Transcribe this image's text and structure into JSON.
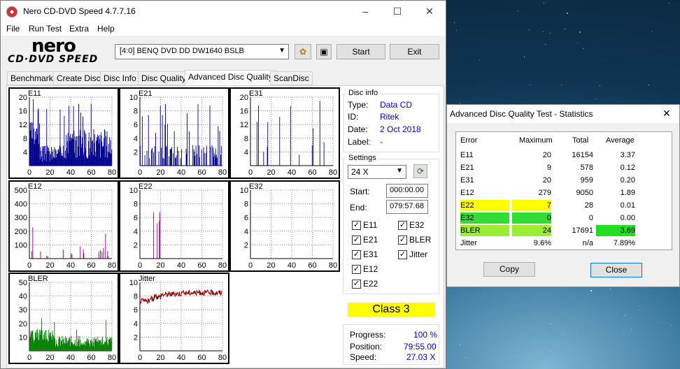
{
  "window": {
    "title": "Nero CD-DVD Speed 4.7.7.16",
    "minimize": "–",
    "maximize": "☐",
    "close": "✕"
  },
  "menu": [
    "File",
    "Run Test",
    "Extra",
    "Help"
  ],
  "logo": {
    "line1": "nero",
    "line2": "CD·DVD SPEED"
  },
  "toolbar": {
    "drive": "[4:0]  BENQ DVD DD DW1640 BSLB",
    "start": "Start",
    "exit": "Exit"
  },
  "tabs": [
    "Benchmark",
    "Create Disc",
    "Disc Info",
    "Disc Quality",
    "Advanced Disc Quality",
    "ScanDisc"
  ],
  "disc_info": {
    "title": "Disc info",
    "type_label": "Type:",
    "type": "Data CD",
    "id_label": "ID:",
    "id": "Ritek",
    "date_label": "Date:",
    "date": "2 Oct 2018",
    "label_label": "Label:",
    "label": "-"
  },
  "settings": {
    "title": "Settings",
    "speed": "24 X",
    "start_label": "Start:",
    "start": "000:00.00",
    "end_label": "End:",
    "end": "079:57.68",
    "checks": [
      {
        "label": "E11",
        "checked": true
      },
      {
        "label": "E32",
        "checked": true
      },
      {
        "label": "E21",
        "checked": true
      },
      {
        "label": "BLER",
        "checked": true
      },
      {
        "label": "E31",
        "checked": true
      },
      {
        "label": "Jitter",
        "checked": true
      },
      {
        "label": "E12",
        "checked": true
      },
      {
        "label": "E22",
        "checked": true
      }
    ]
  },
  "class_label": "Class 3",
  "progress": {
    "progress_label": "Progress:",
    "progress": "100 %",
    "position_label": "Position:",
    "position": "79:55.00",
    "speed_label": "Speed:",
    "speed": "27.03 X"
  },
  "chart_data": [
    {
      "type": "bar",
      "title": "E11",
      "x_ticks": [
        0,
        20,
        40,
        60,
        80
      ],
      "y_ticks": [
        4,
        8,
        12,
        16,
        20
      ],
      "ylim": [
        0,
        20
      ],
      "color": "#00008b",
      "profile": "dense"
    },
    {
      "type": "bar",
      "title": "E21",
      "x_ticks": [
        0,
        20,
        40,
        60,
        80
      ],
      "y_ticks": [
        2,
        4,
        6,
        8,
        10
      ],
      "ylim": [
        0,
        10
      ],
      "color": "#00008b",
      "profile": "mid"
    },
    {
      "type": "bar",
      "title": "E31",
      "x_ticks": [
        0,
        20,
        40,
        60,
        80
      ],
      "y_ticks": [
        4,
        8,
        12,
        16,
        20
      ],
      "ylim": [
        0,
        20
      ],
      "color": "#00008b",
      "profile": "spiky"
    },
    {
      "type": "bar",
      "title": "E12",
      "x_ticks": [
        0,
        20,
        40,
        60,
        80
      ],
      "y_ticks": [
        100,
        200,
        300,
        400,
        500
      ],
      "ylim": [
        0,
        500
      ],
      "color": "#800080",
      "profile": "sparse"
    },
    {
      "type": "bar",
      "title": "E22",
      "x_ticks": [
        0,
        20,
        40,
        60,
        80
      ],
      "y_ticks": [
        2,
        4,
        6,
        8,
        10
      ],
      "ylim": [
        0,
        10
      ],
      "color": "#800080",
      "profile": "e22"
    },
    {
      "type": "bar",
      "title": "E32",
      "x_ticks": [
        0,
        20,
        40,
        60,
        80
      ],
      "y_ticks": [
        2,
        4,
        6,
        8,
        10
      ],
      "ylim": [
        0,
        10
      ],
      "color": "#800080",
      "profile": "none"
    },
    {
      "type": "bar",
      "title": "BLER",
      "x_ticks": [
        0,
        20,
        40,
        60,
        80
      ],
      "y_ticks": [
        10,
        20,
        30,
        40,
        50
      ],
      "ylim": [
        0,
        50
      ],
      "color": "#008000",
      "profile": "bler"
    },
    {
      "type": "line",
      "title": "Jitter",
      "x_ticks": [
        0,
        20,
        40,
        60,
        80
      ],
      "y_ticks": [
        2,
        4,
        6,
        8,
        10
      ],
      "ylim": [
        0,
        10
      ],
      "color": "#8b0000",
      "profile": "jitter"
    }
  ],
  "stats": {
    "title": "Advanced Disc Quality Test - Statistics",
    "headers": [
      "Error",
      "Maximum",
      "Total",
      "Average"
    ],
    "rows": [
      {
        "name": "E11",
        "max": "20",
        "total": "16154",
        "avg": "3.37",
        "hl": ""
      },
      {
        "name": "E21",
        "max": "9",
        "total": "578",
        "avg": "0.12",
        "hl": ""
      },
      {
        "name": "E31",
        "max": "20",
        "total": "959",
        "avg": "0.20",
        "hl": ""
      },
      {
        "name": "E12",
        "max": "279",
        "total": "9050",
        "avg": "1.89",
        "hl": ""
      },
      {
        "name": "E22",
        "max": "7",
        "total": "28",
        "avg": "0.01",
        "hl": "#ffff00"
      },
      {
        "name": "E32",
        "max": "0",
        "total": "0",
        "avg": "0.00",
        "hl": "#33dd33"
      },
      {
        "name": "BLER",
        "max": "24",
        "total": "17691",
        "avg": "3.69",
        "hl": "#99ee33"
      },
      {
        "name": "Jitter",
        "max": "9.6%",
        "total": "n/a",
        "avg": "7.89%",
        "hl": ""
      }
    ],
    "copy": "Copy",
    "close_btn": "Close",
    "close_x": "✕"
  }
}
